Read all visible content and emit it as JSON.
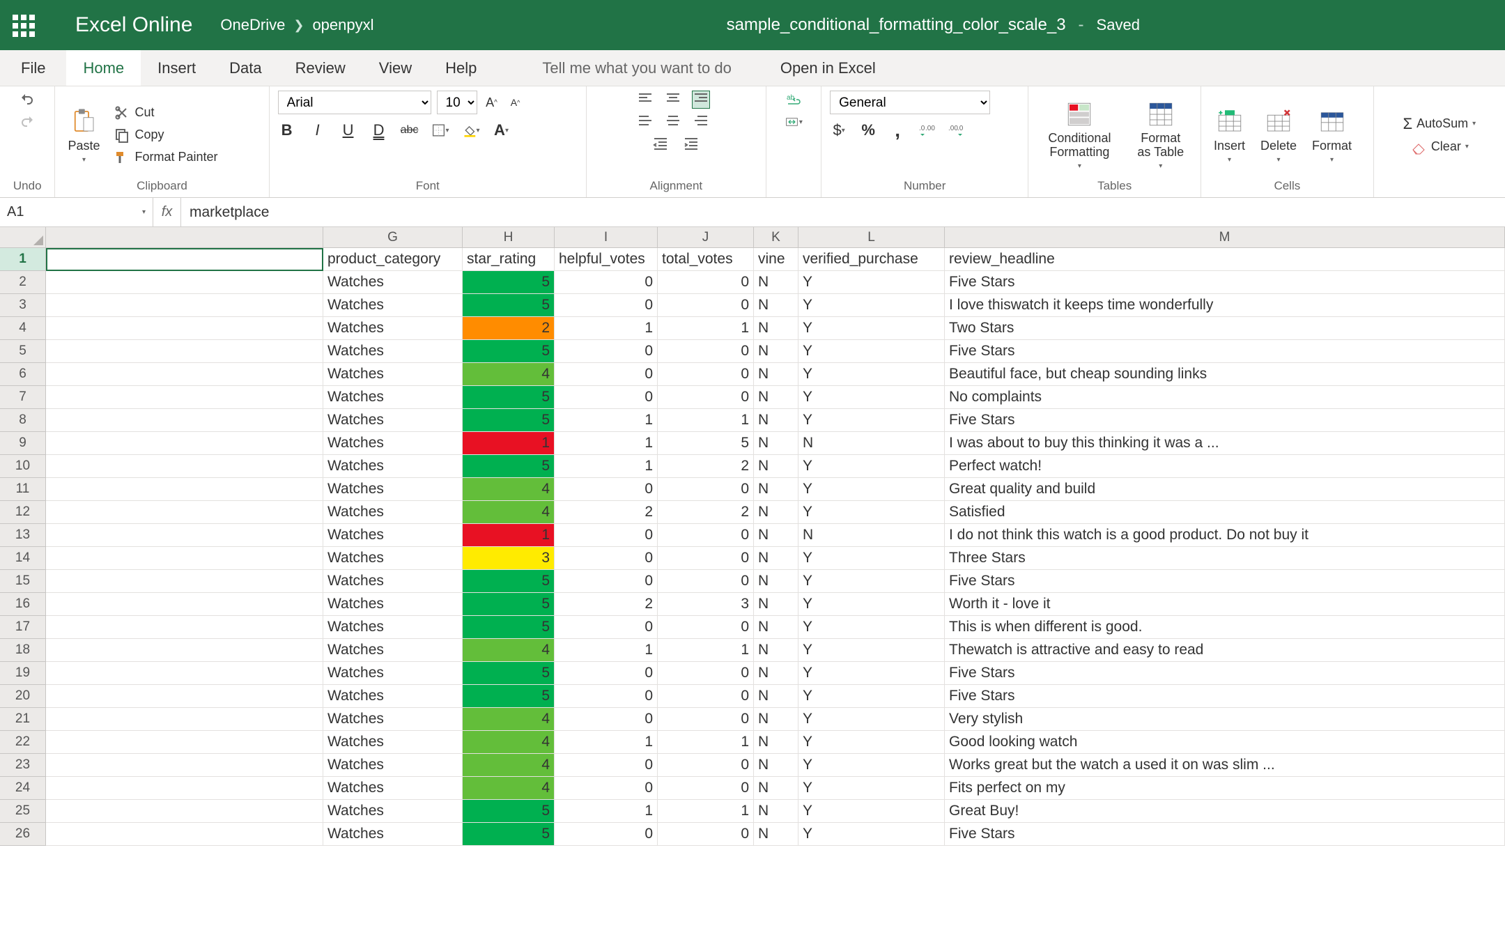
{
  "header": {
    "app_name": "Excel Online",
    "location_root": "OneDrive",
    "location_leaf": "openpyxl",
    "doc_title": "sample_conditional_formatting_color_scale_3",
    "saved_status": "Saved"
  },
  "tabs": {
    "file": "File",
    "home": "Home",
    "insert": "Insert",
    "data": "Data",
    "review": "Review",
    "view": "View",
    "help": "Help",
    "tell_me": "Tell me what you want to do",
    "open_in_excel": "Open in Excel"
  },
  "ribbon": {
    "undo": {
      "group_label": "Undo"
    },
    "clipboard": {
      "group_label": "Clipboard",
      "paste": "Paste",
      "cut": "Cut",
      "copy": "Copy",
      "format_painter": "Format Painter"
    },
    "font": {
      "group_label": "Font",
      "font_name": "Arial",
      "font_size": "10",
      "bold": "B",
      "italic": "I",
      "underline": "U",
      "dunderline": "D",
      "strike": "abc"
    },
    "alignment": {
      "group_label": "Alignment"
    },
    "number": {
      "group_label": "Number",
      "format": "General",
      "currency": "$",
      "percent": "%",
      "comma": ","
    },
    "tables": {
      "group_label": "Tables",
      "cond_format": "Conditional Formatting",
      "format_as_table": "Format as Table"
    },
    "cells": {
      "group_label": "Cells",
      "insert": "Insert",
      "delete": "Delete",
      "format": "Format"
    },
    "editing": {
      "autosum": "AutoSum",
      "clear": "Clear"
    }
  },
  "formula_bar": {
    "name_box": "A1",
    "fx": "fx",
    "value": "marketplace"
  },
  "grid": {
    "columns": [
      "G",
      "H",
      "I",
      "J",
      "K",
      "L",
      "M"
    ],
    "headers": {
      "G": "product_category",
      "H": "star_rating",
      "I": "helpful_votes",
      "J": "total_votes",
      "K": "vine",
      "L": "verified_purchase",
      "M": "review_headline"
    },
    "rows": [
      {
        "n": 2,
        "G": "Watches",
        "H": 5,
        "I": 0,
        "J": 0,
        "K": "N",
        "L": "Y",
        "M": "Five Stars"
      },
      {
        "n": 3,
        "G": "Watches",
        "H": 5,
        "I": 0,
        "J": 0,
        "K": "N",
        "L": "Y",
        "M": "I love thiswatch it keeps time wonderfully"
      },
      {
        "n": 4,
        "G": "Watches",
        "H": 2,
        "I": 1,
        "J": 1,
        "K": "N",
        "L": "Y",
        "M": "Two Stars"
      },
      {
        "n": 5,
        "G": "Watches",
        "H": 5,
        "I": 0,
        "J": 0,
        "K": "N",
        "L": "Y",
        "M": "Five Stars"
      },
      {
        "n": 6,
        "G": "Watches",
        "H": 4,
        "I": 0,
        "J": 0,
        "K": "N",
        "L": "Y",
        "M": "Beautiful face, but cheap sounding links"
      },
      {
        "n": 7,
        "G": "Watches",
        "H": 5,
        "I": 0,
        "J": 0,
        "K": "N",
        "L": "Y",
        "M": "No complaints"
      },
      {
        "n": 8,
        "G": "Watches",
        "H": 5,
        "I": 1,
        "J": 1,
        "K": "N",
        "L": "Y",
        "M": "Five Stars"
      },
      {
        "n": 9,
        "G": "Watches",
        "H": 1,
        "I": 1,
        "J": 5,
        "K": "N",
        "L": "N",
        "M": "I was about to buy this thinking it was a ..."
      },
      {
        "n": 10,
        "G": "Watches",
        "H": 5,
        "I": 1,
        "J": 2,
        "K": "N",
        "L": "Y",
        "M": "Perfect watch!"
      },
      {
        "n": 11,
        "G": "Watches",
        "H": 4,
        "I": 0,
        "J": 0,
        "K": "N",
        "L": "Y",
        "M": "Great quality and build"
      },
      {
        "n": 12,
        "G": "Watches",
        "H": 4,
        "I": 2,
        "J": 2,
        "K": "N",
        "L": "Y",
        "M": "Satisfied"
      },
      {
        "n": 13,
        "G": "Watches",
        "H": 1,
        "I": 0,
        "J": 0,
        "K": "N",
        "L": "N",
        "M": "I do not think this watch is a good product. Do not buy it"
      },
      {
        "n": 14,
        "G": "Watches",
        "H": 3,
        "I": 0,
        "J": 0,
        "K": "N",
        "L": "Y",
        "M": "Three Stars"
      },
      {
        "n": 15,
        "G": "Watches",
        "H": 5,
        "I": 0,
        "J": 0,
        "K": "N",
        "L": "Y",
        "M": "Five Stars"
      },
      {
        "n": 16,
        "G": "Watches",
        "H": 5,
        "I": 2,
        "J": 3,
        "K": "N",
        "L": "Y",
        "M": "Worth it - love it"
      },
      {
        "n": 17,
        "G": "Watches",
        "H": 5,
        "I": 0,
        "J": 0,
        "K": "N",
        "L": "Y",
        "M": "This is when different is good."
      },
      {
        "n": 18,
        "G": "Watches",
        "H": 4,
        "I": 1,
        "J": 1,
        "K": "N",
        "L": "Y",
        "M": "Thewatch is attractive and easy to read"
      },
      {
        "n": 19,
        "G": "Watches",
        "H": 5,
        "I": 0,
        "J": 0,
        "K": "N",
        "L": "Y",
        "M": "Five Stars"
      },
      {
        "n": 20,
        "G": "Watches",
        "H": 5,
        "I": 0,
        "J": 0,
        "K": "N",
        "L": "Y",
        "M": "Five Stars"
      },
      {
        "n": 21,
        "G": "Watches",
        "H": 4,
        "I": 0,
        "J": 0,
        "K": "N",
        "L": "Y",
        "M": "Very stylish"
      },
      {
        "n": 22,
        "G": "Watches",
        "H": 4,
        "I": 1,
        "J": 1,
        "K": "N",
        "L": "Y",
        "M": "Good looking watch"
      },
      {
        "n": 23,
        "G": "Watches",
        "H": 4,
        "I": 0,
        "J": 0,
        "K": "N",
        "L": "Y",
        "M": "Works great but the watch a used it on was slim ..."
      },
      {
        "n": 24,
        "G": "Watches",
        "H": 4,
        "I": 0,
        "J": 0,
        "K": "N",
        "L": "Y",
        "M": "Fits perfect on my"
      },
      {
        "n": 25,
        "G": "Watches",
        "H": 5,
        "I": 1,
        "J": 1,
        "K": "N",
        "L": "Y",
        "M": "Great Buy!"
      },
      {
        "n": 26,
        "G": "Watches",
        "H": 5,
        "I": 0,
        "J": 0,
        "K": "N",
        "L": "Y",
        "M": "Five Stars"
      }
    ]
  }
}
